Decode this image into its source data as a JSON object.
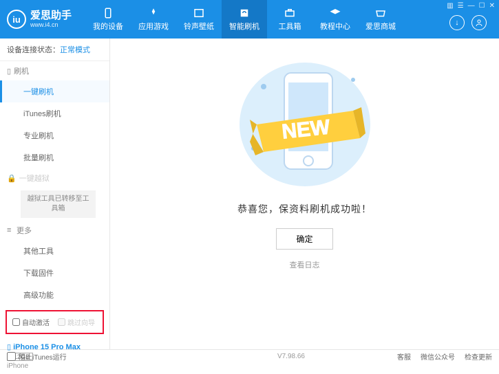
{
  "app": {
    "name": "爱思助手",
    "url": "www.i4.cn"
  },
  "nav": [
    {
      "label": "我的设备"
    },
    {
      "label": "应用游戏"
    },
    {
      "label": "铃声壁纸"
    },
    {
      "label": "智能刷机"
    },
    {
      "label": "工具箱"
    },
    {
      "label": "教程中心"
    },
    {
      "label": "爱思商城"
    }
  ],
  "status": {
    "label": "设备连接状态：",
    "value": "正常模式"
  },
  "sidebar": {
    "sec1": "刷机",
    "items1": [
      "一键刷机",
      "iTunes刷机",
      "专业刷机",
      "批量刷机"
    ],
    "sec2": "一键越狱",
    "transfer": "越狱工具已转移至工具箱",
    "sec3": "更多",
    "items3": [
      "其他工具",
      "下载固件",
      "高级功能"
    ]
  },
  "checks": {
    "auto": "自动激活",
    "skip": "跳过向导"
  },
  "device": {
    "name": "iPhone 15 Pro Max",
    "storage": "512GB",
    "type": "iPhone"
  },
  "main": {
    "banner": "NEW",
    "success": "恭喜您，保资料刷机成功啦！",
    "ok": "确定",
    "log": "查看日志"
  },
  "footer": {
    "block": "阻止iTunes运行",
    "version": "V7.98.66",
    "links": [
      "客服",
      "微信公众号",
      "检查更新"
    ]
  }
}
